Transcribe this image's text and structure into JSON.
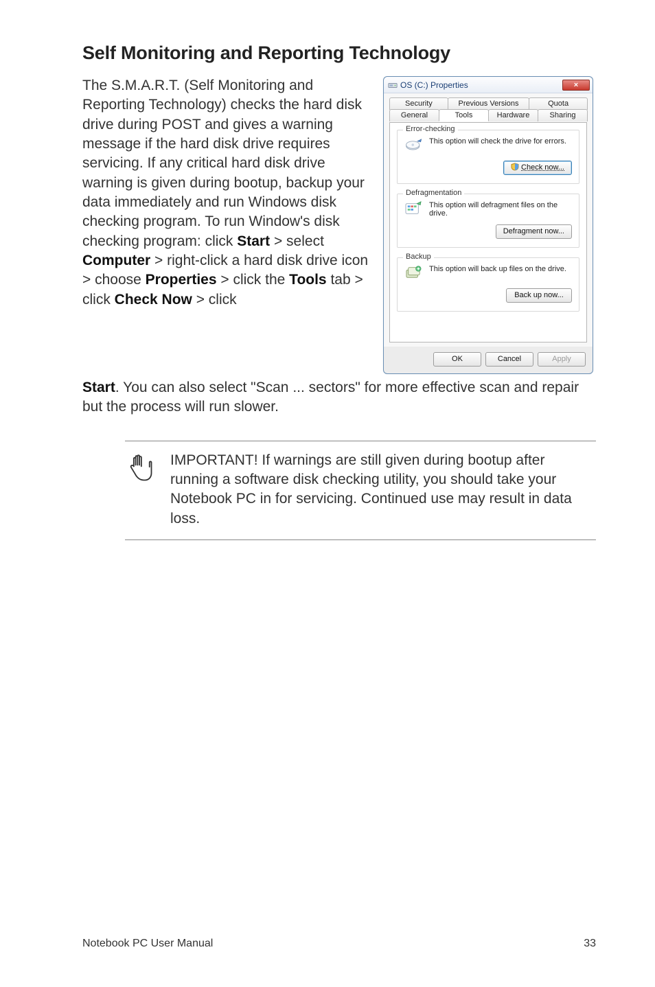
{
  "heading": "Self Monitoring and Reporting Technology",
  "para1": "The S.M.A.R.T. (Self Monitoring and Reporting Technology) checks the hard disk drive during POST and gives a warning message if the hard disk drive requires servicing. If any critical hard disk drive warning is given during bootup, backup your data immediately and run Windows disk checking program. To run Window's disk checking program: click ",
  "b_start": "Start",
  "t_gt1": " > select ",
  "b_computer": "Computer",
  "t_gt2": " > right-click a hard disk drive icon > choose ",
  "b_properties": "Properties",
  "t_gt3": " > click the ",
  "b_tools": "Tools",
  "t_gt4": " tab > click ",
  "b_checknow": "Check Now",
  "t_gt5": " > click ",
  "b_start2": "Start",
  "para2_tail": ". You can also select \"Scan ... sectors\" for more effective scan and repair but the process will run slower.",
  "note": "IMPORTANT! If warnings are still given during bootup after running a software disk checking utility, you should take your Notebook PC in for servicing. Continued use may result in data loss.",
  "footer_left": "Notebook PC User Manual",
  "footer_right": "33",
  "dialog": {
    "title": "OS (C:) Properties",
    "close_glyph": "×",
    "tabs_top": [
      "Security",
      "Previous Versions",
      "Quota"
    ],
    "tabs_bottom": [
      "General",
      "Tools",
      "Hardware",
      "Sharing"
    ],
    "active_tab": "Tools",
    "group_error": {
      "legend": "Error-checking",
      "text": "This option will check the drive for errors.",
      "button": "Check now..."
    },
    "group_defrag": {
      "legend": "Defragmentation",
      "text": "This option will defragment files on the drive.",
      "button": "Defragment now..."
    },
    "group_backup": {
      "legend": "Backup",
      "text": "This option will back up files on the drive.",
      "button": "Back up now..."
    },
    "footer_buttons": {
      "ok": "OK",
      "cancel": "Cancel",
      "apply": "Apply"
    }
  }
}
